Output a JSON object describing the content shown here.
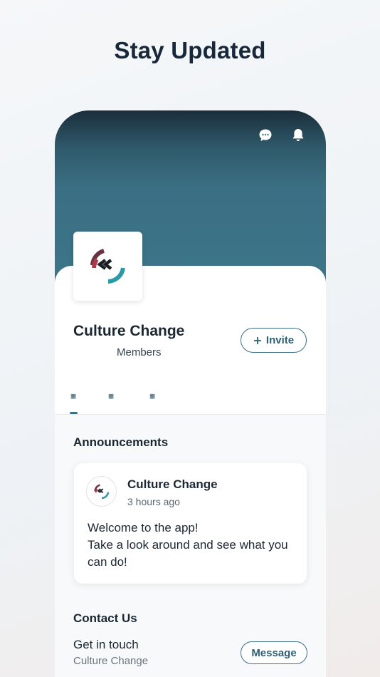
{
  "headline": "Stay Updated",
  "header": {
    "icons": [
      "chat-bubble-icon",
      "bell-icon"
    ]
  },
  "group": {
    "name": "Culture Change",
    "members_label": "Members",
    "invite_label": "Invite"
  },
  "tabs": [
    {
      "glyph": "▦",
      "active": true
    },
    {
      "glyph": "▦",
      "active": false
    },
    {
      "glyph": "▦",
      "active": false
    }
  ],
  "announcements": {
    "title": "Announcements",
    "post": {
      "author": "Culture Change",
      "time": "3 hours ago",
      "body_line1": "Welcome to the app!",
      "body_line2": "Take a look around and see what you can do!"
    }
  },
  "contact": {
    "title": "Contact Us",
    "line": "Get in touch",
    "sub": "Culture Change",
    "message_label": "Message"
  },
  "colors": {
    "accent": "#3b6f83",
    "logo_maroon": "#7a2d3a",
    "logo_teal": "#2c9aa6",
    "text_dark": "#1b2733"
  }
}
